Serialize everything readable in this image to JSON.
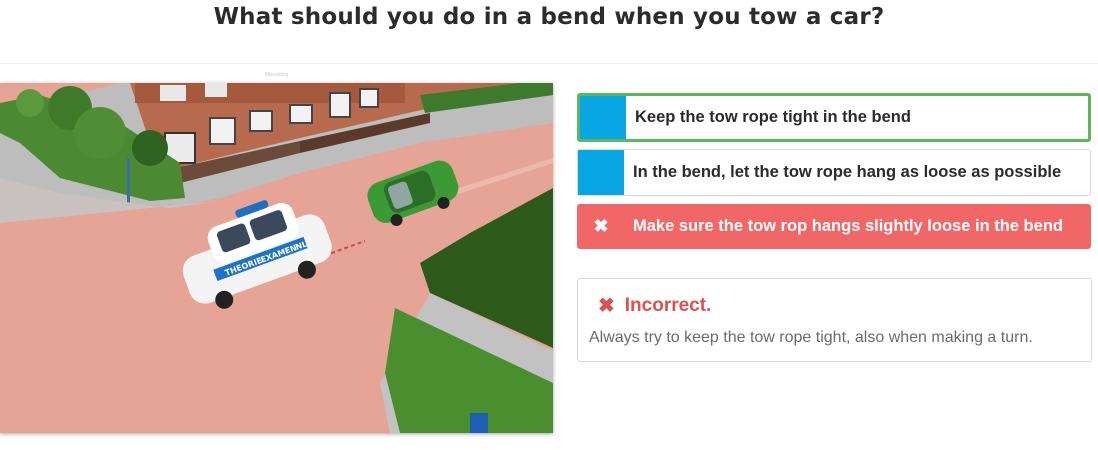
{
  "question": {
    "title": "What should you do in a bend when you tow a car?"
  },
  "scene": {
    "caption": "Afbeelding",
    "car_brand_1": "THEORIE",
    "car_brand_2": "EXAMEN",
    "car_brand_3": ".NL"
  },
  "answers": [
    {
      "label": "Keep the tow rope tight in the bend",
      "state": "correct"
    },
    {
      "label": "In the bend, let the tow rope hang as loose as possible",
      "state": "neutral"
    },
    {
      "label": "Make sure the tow rop hangs slightly loose in the bend",
      "state": "wrong",
      "mark": "✖"
    }
  ],
  "feedback": {
    "icon": "✖",
    "title": "Incorrect.",
    "text": "Always try to keep the tow rope tight, also when making a turn."
  },
  "colors": {
    "correct": "#5cb85c",
    "wrong": "#f16767",
    "marker": "#08a7e3",
    "error_text": "#d9534f"
  }
}
